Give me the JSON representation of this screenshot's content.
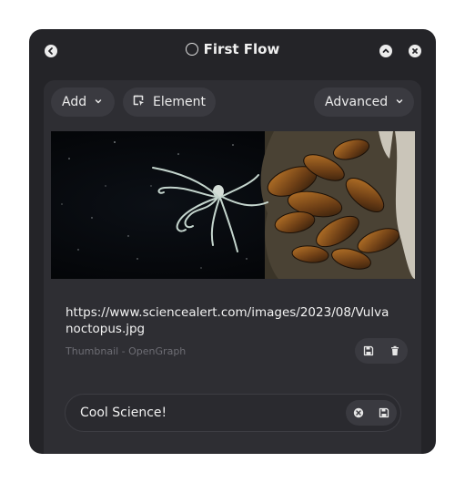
{
  "window": {
    "title": "First Flow",
    "controls": [
      "back-icon",
      "minimize-icon",
      "close-icon"
    ]
  },
  "toolbar": {
    "add_label": "Add",
    "element_label": "Element",
    "advanced_label": "Advanced"
  },
  "item": {
    "image_alt": "Deep sea octopus swimming near a cluster of mussels",
    "url": "https://www.sciencealert.com/images/2023/08/Vulvanoctopus.jpg",
    "caption": "Thumbnail - OpenGraph",
    "actions": [
      "save-icon",
      "trash-icon"
    ]
  },
  "input": {
    "value": "Cool Science!",
    "actions": [
      "clear-icon",
      "save-icon"
    ]
  },
  "colors": {
    "window_bg": "#242428",
    "panel_bg": "#2e2e33",
    "pill_bg": "#3a3a40",
    "text": "#ececec",
    "muted": "#6d6d74"
  }
}
